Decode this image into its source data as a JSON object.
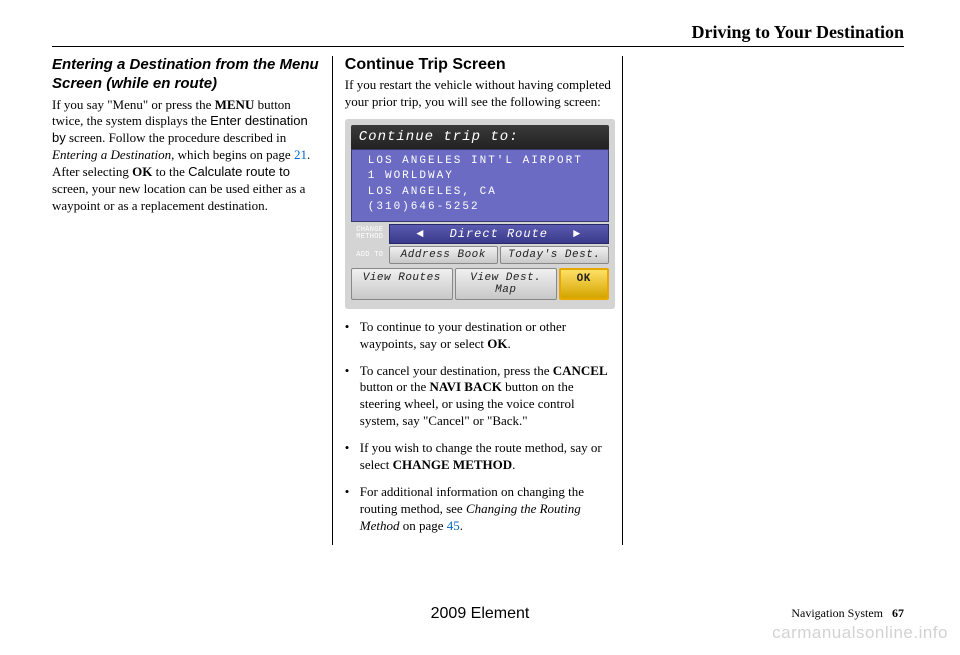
{
  "page": {
    "title": "Driving to Your Destination",
    "footer_model": "2009  Element",
    "footer_section": "Navigation System",
    "footer_page": "67",
    "watermark": "carmanualsonline.info"
  },
  "col1": {
    "heading": "Entering a Destination from the Menu Screen (while en route)",
    "body_parts": {
      "t1": "If you say \"Menu\" or press the ",
      "menu": "MENU",
      "t2": " button twice, the system displays the ",
      "enter_dest_by": "Enter destination by",
      "t3": " screen. Follow the procedure described in ",
      "entering_a_dest": "Entering a Destination",
      "t4": ", which begins on page",
      "page_link": " 21",
      "t5": ". After selecting ",
      "ok": "OK",
      "t6": " to the ",
      "calc_route_to": "Calculate route to",
      "t7": " screen, your new location can be used either as a waypoint or as a replacement destination."
    }
  },
  "col2": {
    "heading": "Continue Trip Screen",
    "intro": "If you restart the vehicle without having completed your prior trip, you will see the following screen:",
    "screen": {
      "title": "Continue trip to:",
      "dest_line1": "LOS ANGELES INT'L AIRPORT",
      "dest_line2": "1 WORLDWAY",
      "dest_line3": "LOS ANGELES, CA",
      "dest_line4": "(310)646-5252",
      "label_change": "CHANGE METHOD",
      "direct_route": "Direct Route",
      "label_addto": "ADD TO",
      "btn_address_book": "Address Book",
      "btn_todays_dest": "Today's Dest.",
      "btn_view_routes": "View Routes",
      "btn_view_dest_map": "View Dest. Map",
      "btn_ok": "OK"
    },
    "bullets": {
      "b1a": "To continue to your destination or other waypoints, say or select ",
      "b1_ok": "OK",
      "b1b": ".",
      "b2a": "To cancel your destination, press the ",
      "b2_cancel": "CANCEL",
      "b2b": " button or the ",
      "b2_navi_back": "NAVI BACK",
      "b2c": " button on the steering wheel, or using the voice control system, say \"Cancel\" or \"Back.\"",
      "b3a": "If you wish to change the route method, say or select ",
      "b3_change": "CHANGE METHOD",
      "b3b": ".",
      "b4a": "For additional information on changing the routing method, see ",
      "b4_italic": "Changing the Routing Method",
      "b4b": " on page",
      "b4_link": " 45",
      "b4c": "."
    }
  }
}
